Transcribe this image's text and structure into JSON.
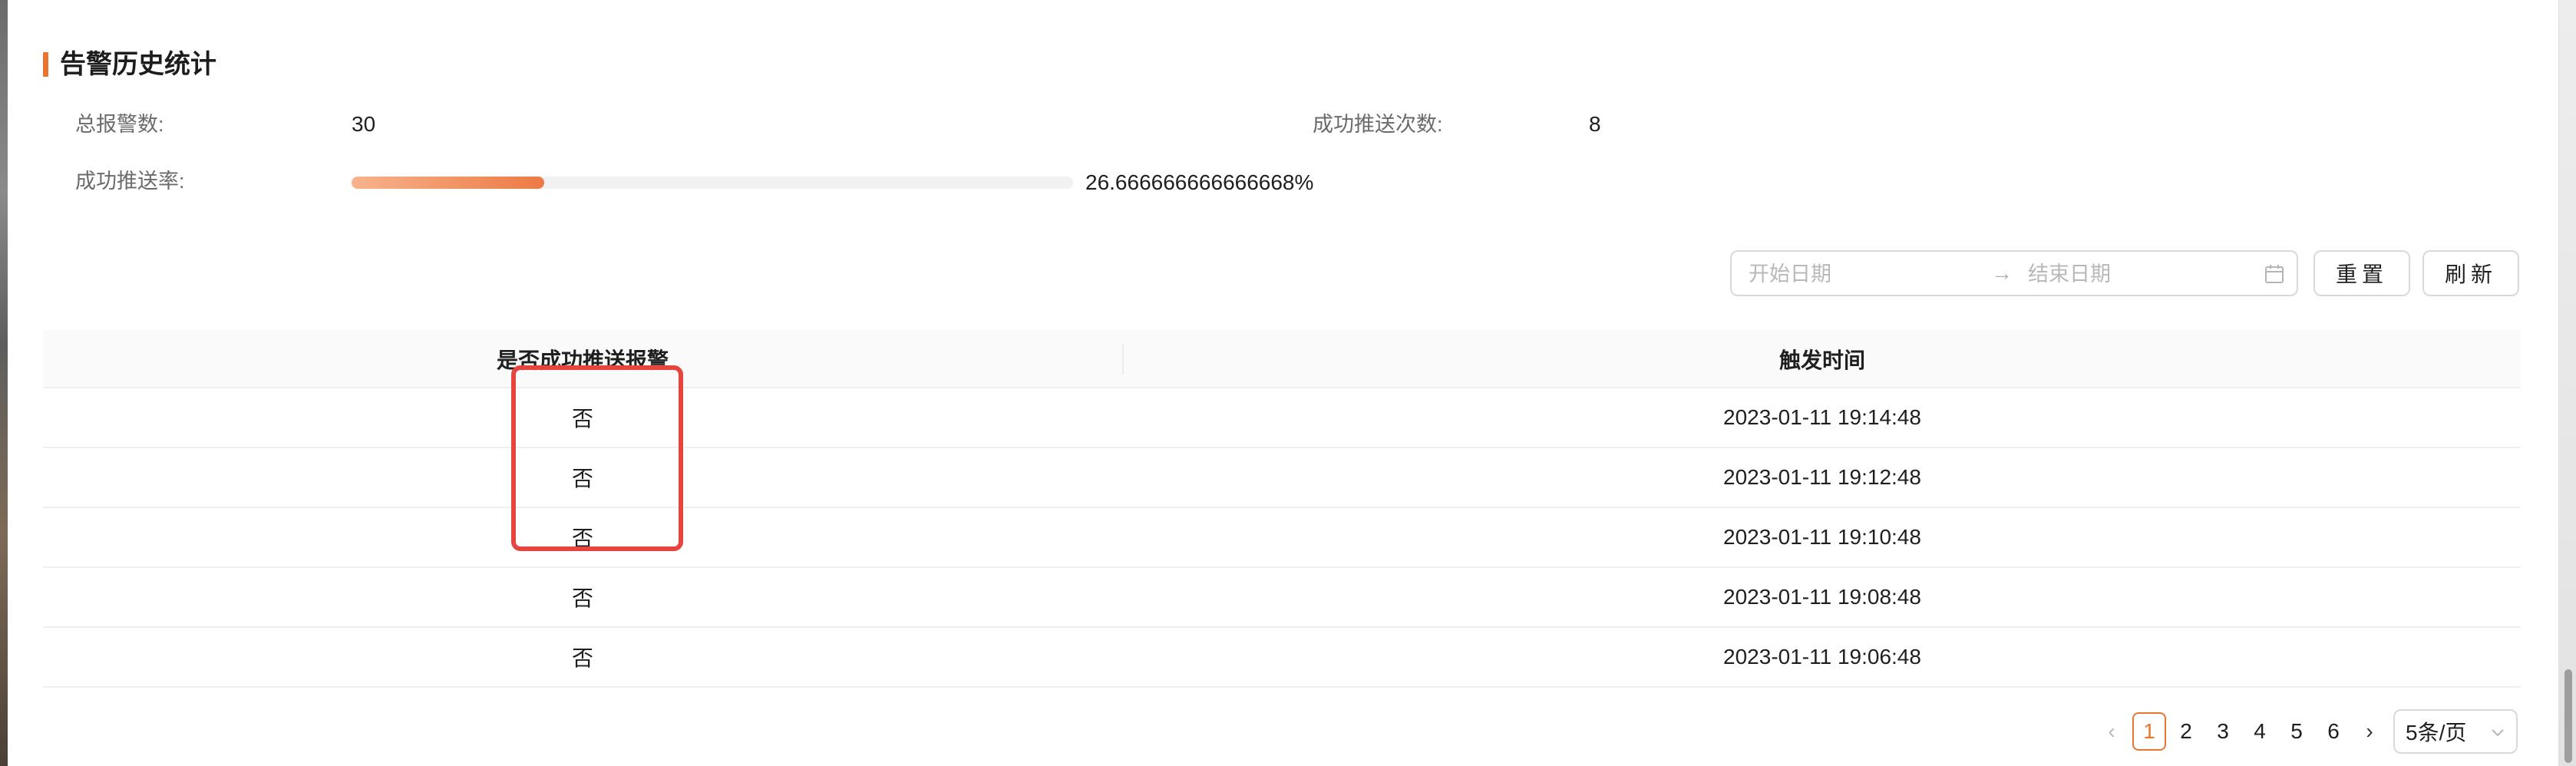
{
  "section": {
    "title": "告警历史统计"
  },
  "stats": {
    "total_label": "总报警数:",
    "total_value": "30",
    "success_count_label": "成功推送次数:",
    "success_count_value": "8",
    "rate_label": "成功推送率:",
    "rate_text": "26.666666666666668%",
    "rate_fraction": 0.26666666666666666
  },
  "filters": {
    "start_placeholder": "开始日期",
    "end_placeholder": "结束日期",
    "reset_label": "重置",
    "refresh_label": "刷新"
  },
  "table": {
    "columns": [
      "是否成功推送报警",
      "触发时间"
    ],
    "rows": [
      {
        "success": "否",
        "time": "2023-01-11 19:14:48"
      },
      {
        "success": "否",
        "time": "2023-01-11 19:12:48"
      },
      {
        "success": "否",
        "time": "2023-01-11 19:10:48"
      },
      {
        "success": "否",
        "time": "2023-01-11 19:08:48"
      },
      {
        "success": "否",
        "time": "2023-01-11 19:06:48"
      }
    ]
  },
  "pagination": {
    "prev_icon": "chevron-left-icon",
    "next_icon": "chevron-right-icon",
    "pages": [
      "1",
      "2",
      "3",
      "4",
      "5",
      "6"
    ],
    "current": "1",
    "page_size_label": "5条/页"
  },
  "colors": {
    "accent": "#e8762f",
    "annotation": "#e5443f"
  }
}
